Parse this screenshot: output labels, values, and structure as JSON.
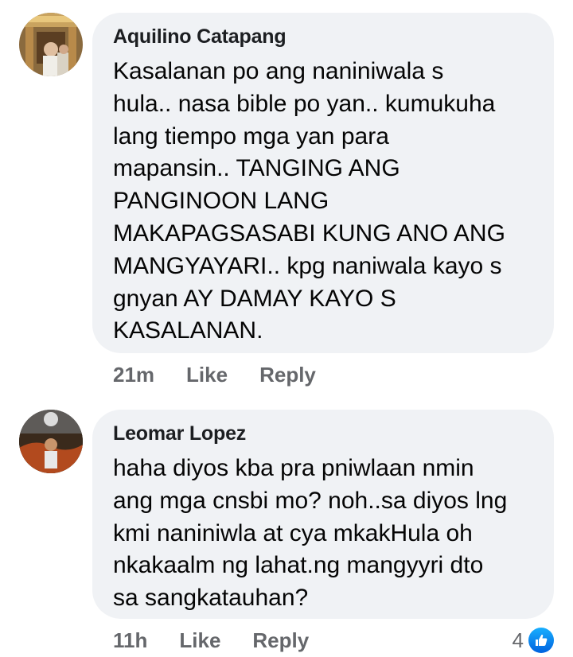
{
  "comments": [
    {
      "author": "Aquilino Catapang",
      "text": "Kasalanan po ang naniniwala s\nhula.. nasa bible po yan.. kumukuha\nlang tiempo mga yan para\nmapansin.. TANGING ANG\nPANGINOON LANG\nMAKAPAGSASABI KUNG ANO ANG\nMANGYAYARI.. kpg naniwala kayo s\ngnyan AY DAMAY KAYO S\nKASALANAN.",
      "time": "21m",
      "like_label": "Like",
      "reply_label": "Reply"
    },
    {
      "author": "Leomar Lopez",
      "text": "haha diyos kba pra pniwlaan nmin\nang mga cnsbi mo? noh..sa diyos lng\nkmi naniniwla at cya mkakHula oh\nnkakaalm  ng lahat.ng mangyyri dto\nsa sangkatauhan?",
      "time": "11h",
      "like_label": "Like",
      "reply_label": "Reply",
      "reaction_count": "4"
    }
  ],
  "colors": {
    "bubble": "#f0f2f5",
    "meta_text": "#65676b",
    "like_blue": "#1877f2"
  },
  "icons": {
    "reaction": "like-thumb-icon"
  }
}
